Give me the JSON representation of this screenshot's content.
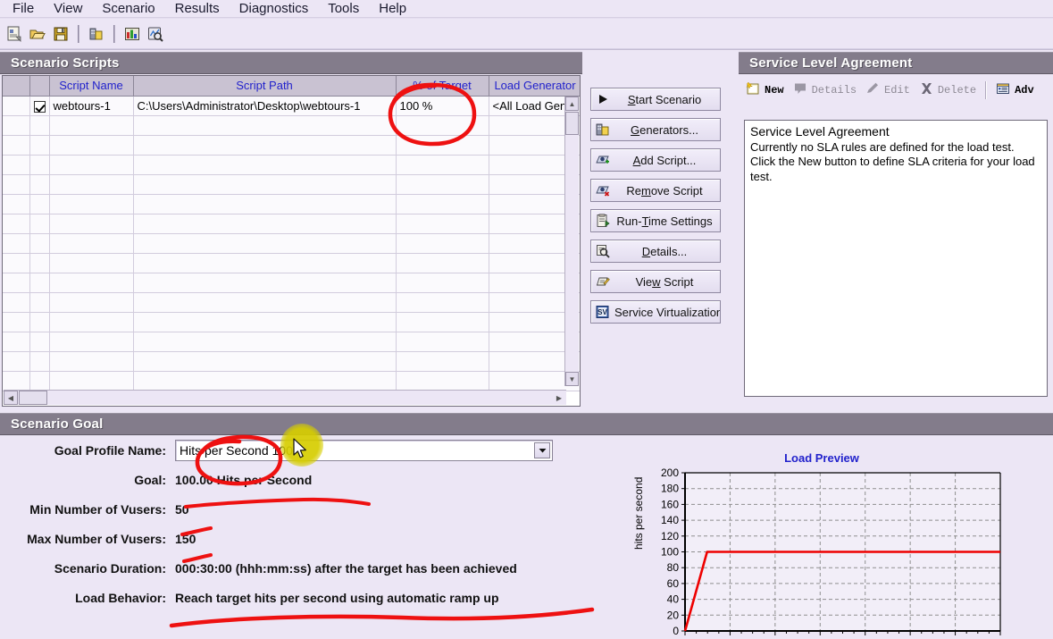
{
  "menu": {
    "items": [
      "File",
      "View",
      "Scenario",
      "Results",
      "Diagnostics",
      "Tools",
      "Help"
    ]
  },
  "toolbar": {
    "buttons": [
      {
        "name": "new-scenario-icon",
        "title": "New Scenario"
      },
      {
        "name": "open-scenario-icon",
        "title": "Open"
      },
      {
        "name": "save-scenario-icon",
        "title": "Save"
      },
      {
        "name": "generators-icon",
        "title": "Load Generators"
      },
      {
        "name": "results-icon",
        "title": "Results"
      },
      {
        "name": "analysis-icon",
        "title": "Analysis"
      }
    ]
  },
  "scripts_panel": {
    "title": "Scenario Scripts",
    "columns": [
      "",
      "",
      "Script Name",
      "Script Path",
      "% of Target",
      "Load Generator"
    ],
    "rows": [
      {
        "checked": true,
        "script_name": "webtours-1",
        "script_path": "C:\\Users\\Administrator\\Desktop\\webtours-1",
        "percent_of_target": "100 %",
        "load_generator": "<All Load Gene",
        "selected_cell": "percent_of_target"
      }
    ],
    "empty_row_count": 14
  },
  "actions": {
    "buttons": [
      {
        "label": "Start Scenario",
        "accel": "S",
        "icon": "play-icon"
      },
      {
        "label": "Generators...",
        "accel": "G",
        "icon": "generators-icon"
      },
      {
        "label": "Add Script...",
        "accel": "A",
        "icon": "add-script-icon"
      },
      {
        "label": "Remove Script",
        "accel": "m",
        "icon": "remove-script-icon"
      },
      {
        "label": "Run-Time Settings",
        "accel": "T",
        "icon": "runtime-settings-icon"
      },
      {
        "label": "Details...",
        "accel": "D",
        "icon": "details-icon"
      },
      {
        "label": "View Script",
        "accel": "w",
        "icon": "view-script-icon"
      },
      {
        "label": "Service Virtualization",
        "accel": "",
        "icon": "service-virtualization-icon"
      }
    ]
  },
  "sla": {
    "title": "Service Level Agreement",
    "toolbar": [
      {
        "label": "New",
        "enabled": true,
        "icon": "new-sla-icon"
      },
      {
        "label": "Details",
        "enabled": false,
        "icon": "details-sla-icon"
      },
      {
        "label": "Edit",
        "enabled": false,
        "icon": "edit-sla-icon"
      },
      {
        "label": "Delete",
        "enabled": false,
        "icon": "delete-sla-icon"
      },
      {
        "label": "Adv",
        "enabled": true,
        "icon": "advanced-sla-icon"
      }
    ],
    "box_title": "Service Level Agreement",
    "box_text": "Currently no SLA rules are defined for the load test. Click the New button to define SLA criteria for your load test."
  },
  "goal": {
    "title": "Scenario Goal",
    "profile_label": "Goal Profile Name:",
    "profile_value": "Hits per Second 100",
    "fields": [
      {
        "label": "Goal:",
        "value": "100.00 Hits per Second"
      },
      {
        "label": "Min Number of Vusers:",
        "value": "50"
      },
      {
        "label": "Max Number of Vusers:",
        "value": "150"
      },
      {
        "label": "Scenario Duration:",
        "value": "000:30:00 (hhh:mm:ss) after the target has been achieved"
      },
      {
        "label": "Load Behavior:",
        "value": "Reach target hits per second using automatic ramp up"
      }
    ]
  },
  "chart_data": {
    "type": "line",
    "title": "Load Preview",
    "xlabel": "",
    "ylabel": "hits per second",
    "ylim": [
      0,
      200
    ],
    "yticks": [
      0,
      20,
      40,
      60,
      80,
      100,
      120,
      140,
      160,
      180,
      200
    ],
    "xlim": [
      0,
      100
    ],
    "grid": true,
    "legend": "none",
    "series": [
      {
        "name": "hits per second",
        "color": "#ee0000",
        "x": [
          0,
          7,
          100
        ],
        "y": [
          0,
          100,
          100
        ]
      }
    ]
  },
  "annotations": {
    "colors": {
      "ink": "#ee1111",
      "highlight": "#d6cd00"
    },
    "marks": [
      "circle around % of Target cell",
      "circle around Goal Profile Name combo",
      "underline under Goal value",
      "underline under Min Number of Vusers",
      "underline under Max Number of Vusers",
      "underline under Scenario Duration"
    ]
  }
}
